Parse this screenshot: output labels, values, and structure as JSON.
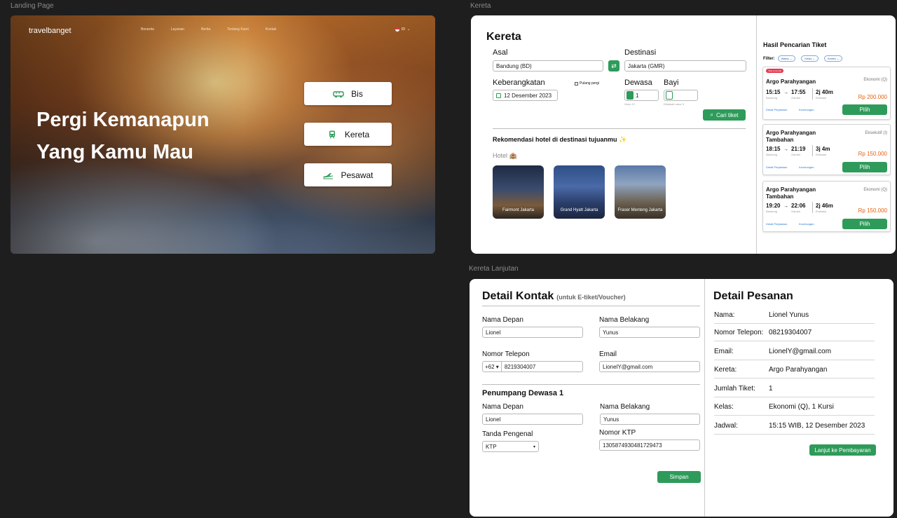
{
  "frames": {
    "landing_label": "Landing Page",
    "kereta_label": "Kereta",
    "lanjut_label": "Kereta Lanjutan"
  },
  "landing": {
    "brand": "travelbanget",
    "nav": [
      "Beranda",
      "Layanan",
      "Berita",
      "Tentang Kami",
      "Kontak"
    ],
    "lang": "ID",
    "hero_line1": "Pergi Kemanapun",
    "hero_line2": "Yang Kamu Mau",
    "modes": [
      "Bis",
      "Kereta",
      "Pesawat"
    ]
  },
  "kereta": {
    "title": "Kereta",
    "asal_label": "Asal",
    "asal_value": "Bandung (BD)",
    "destinasi_label": "Destinasi",
    "destinasi_value": "Jakarta (GMR)",
    "keberangkatan_label": "Keberangkatan",
    "keberangkatan_value": "12 Desember 2023",
    "pulang_pergi": "Pulang pergi",
    "dewasa_label": "Dewasa",
    "dewasa_value": "1",
    "dewasa_hint": "Umur 3+",
    "bayi_label": "Bayi",
    "bayi_hint": "Dibawah umur 3",
    "cari_tiket": "Cari tiket",
    "rekomendasi": "Rekomendasi hotel di destinasi tujuanmu ✨",
    "hotel_label": "Hotel 🏨",
    "hotels": [
      "Fairmont Jakarta",
      "Grand Hyatt Jakarta",
      "Fraser Menteng Jakarta"
    ],
    "hasil_title": "Hasil Pencarian Tiket",
    "filter_label": "Filter:",
    "filters": [
      "Waktu",
      "Kelas",
      "Kereta"
    ],
    "results": [
      {
        "badge": "Tiket termurah",
        "name": "Argo Parahyangan",
        "class": "Ekonomi (Q)",
        "depart": "15:15",
        "depart_station": "Bandung",
        "arrive": "17:55",
        "arrive_station": "Gambir",
        "duration": "2j 40m",
        "duration_note": "Estimasi",
        "price": "Rp 200.000",
        "link1": "Detail Perjalanan",
        "link2": "Keuntungan",
        "button": "Pilih"
      },
      {
        "name": "Argo Parahyangan Tambahan",
        "class": "Eksekutif (I)",
        "depart": "18:15",
        "depart_station": "Bandung",
        "arrive": "21:19",
        "arrive_station": "Gambir",
        "duration": "3j 4m",
        "duration_note": "Estimasi",
        "price": "Rp 150.000",
        "link1": "Detail Perjalanan",
        "link2": "Keuntungan",
        "button": "Pilih"
      },
      {
        "name": "Argo Parahyangan Tambahan",
        "class": "Ekonomi (Q)",
        "depart": "19:20",
        "depart_station": "Bandung",
        "arrive": "22:06",
        "arrive_station": "Gambir",
        "duration": "2j 46m",
        "duration_note": "Estimasi",
        "price": "Rp 150.000",
        "link1": "Detail Perjalanan",
        "link2": "Keuntungan",
        "button": "Pilih"
      }
    ]
  },
  "lanjut": {
    "detail_kontak": "Detail Kontak",
    "detail_kontak_sub": "(untuk E-tiket/Voucher)",
    "nama_depan_label": "Nama Depan",
    "nama_depan_value": "Lionel",
    "nama_belakang_label": "Nama Belakang",
    "nama_belakang_value": "Yunus",
    "telepon_label": "Nomor Telepon",
    "telepon_code": "+62",
    "telepon_value": "8219304007",
    "email_label": "Email",
    "email_value": "LionelY@gmail.com",
    "penumpang_title": "Penumpang Dewasa 1",
    "p_nama_depan_label": "Nama Depan",
    "p_nama_depan_value": "Lionel",
    "p_nama_belakang_label": "Nama Belakang",
    "p_nama_belakang_value": "Yunus",
    "tanda_label": "Tanda Pengenal",
    "tanda_value": "KTP",
    "ktp_label": "Nomor KTP",
    "ktp_value": "1305874930481729473",
    "simpan": "Simpan",
    "detail_pesanan": "Detail Pesanan",
    "pesanan": [
      {
        "k": "Nama:",
        "v": "Lionel Yunus"
      },
      {
        "k": "Nomor Telepon:",
        "v": "08219304007"
      },
      {
        "k": "Email:",
        "v": "LionelY@gmail.com"
      },
      {
        "k": "Kereta:",
        "v": "Argo Parahyangan"
      },
      {
        "k": "Jumlah Tiket:",
        "v": "1"
      },
      {
        "k": "Kelas:",
        "v": "Ekonomi (Q), 1 Kursi"
      },
      {
        "k": "Jadwal:",
        "v": "15:15 WIB, 12 Desember 2023"
      }
    ],
    "lanjut_button": "Lanjut ke Pembayaran"
  },
  "colors": {
    "accent_green": "#2e9b5a",
    "price_orange": "#e8600f",
    "badge_red": "#e53950",
    "canvas_bg": "#1e1e1e"
  }
}
